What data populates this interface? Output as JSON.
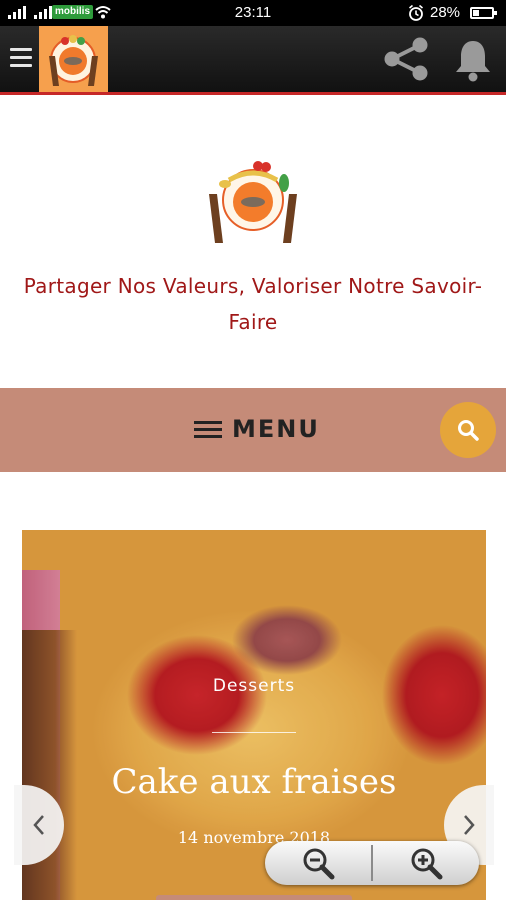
{
  "status_bar": {
    "carrier": "mobilis",
    "time": "23:11",
    "battery_percent": "28%",
    "battery_level": 0.28,
    "icons": [
      "signal-icon",
      "signal-icon",
      "wifi-icon",
      "alarm-icon",
      "battery-icon"
    ]
  },
  "app_bar": {
    "icons": [
      "menu-icon",
      "share-icon",
      "bell-icon"
    ]
  },
  "header": {
    "tagline": "Partager Nos Valeurs, Valoriser Notre Savoir-Faire"
  },
  "menu_bar": {
    "label": "MENU",
    "search_icon": "search-icon",
    "accent_color": "#e5a53a",
    "bar_color": "#c58b78"
  },
  "featured_post": {
    "category": "Desserts",
    "title": "Cake aux fraises",
    "date": "14 novembre 2018"
  },
  "carousel": {
    "prev_icon": "chevron-left-icon",
    "next_icon": "chevron-right-icon"
  },
  "zoom_controls": {
    "icons": [
      "zoom-out-icon",
      "zoom-in-icon"
    ]
  },
  "colors": {
    "tagline": "#a01818",
    "appbar_border": "#c62828"
  }
}
